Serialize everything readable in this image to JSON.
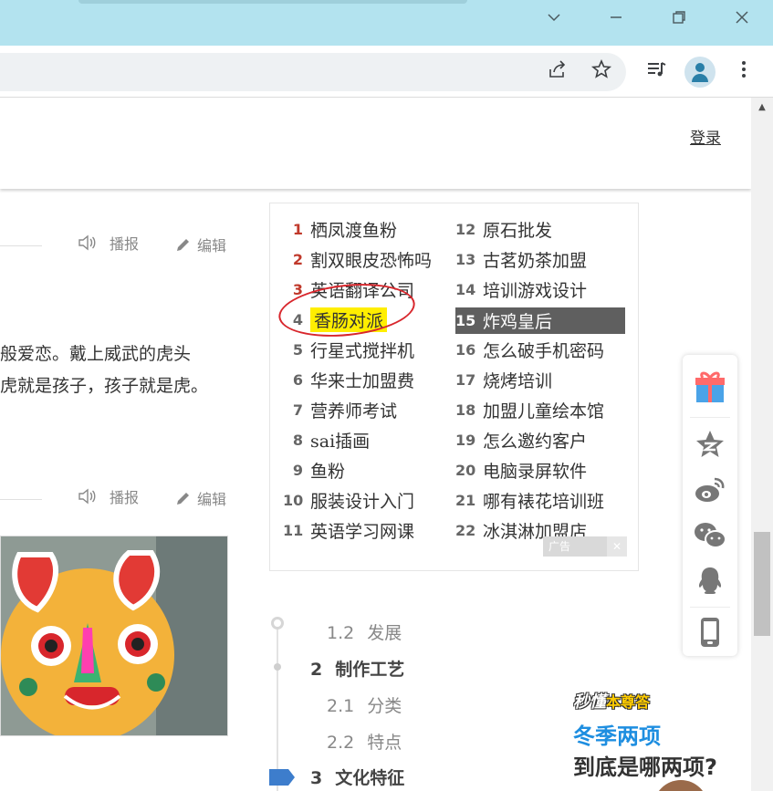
{
  "login_label": "登录",
  "actions": {
    "broadcast": "播报",
    "edit": "编辑"
  },
  "body_lines": [
    "般爱恋。戴上威武的虎头",
    "虎就是孩子，孩子就是虎。"
  ],
  "hot_list": {
    "left": [
      {
        "num": "1",
        "label": "栖凤渡鱼粉"
      },
      {
        "num": "2",
        "label": "割双眼皮恐怖吗"
      },
      {
        "num": "3",
        "label": "英语翻译公司"
      },
      {
        "num": "4",
        "label": "香肠对派"
      },
      {
        "num": "5",
        "label": "行星式搅拌机"
      },
      {
        "num": "6",
        "label": "华来士加盟费"
      },
      {
        "num": "7",
        "label": "营养师考试"
      },
      {
        "num": "8",
        "label": "sai插画"
      },
      {
        "num": "9",
        "label": "鱼粉"
      },
      {
        "num": "10",
        "label": "服装设计入门"
      },
      {
        "num": "11",
        "label": "英语学习网课"
      }
    ],
    "right": [
      {
        "num": "12",
        "label": "原石批发"
      },
      {
        "num": "13",
        "label": "古茗奶茶加盟"
      },
      {
        "num": "14",
        "label": "培训游戏设计"
      },
      {
        "num": "15",
        "label": "炸鸡皇后"
      },
      {
        "num": "16",
        "label": "怎么破手机密码"
      },
      {
        "num": "17",
        "label": "烧烤培训"
      },
      {
        "num": "18",
        "label": "加盟儿童绘本馆"
      },
      {
        "num": "19",
        "label": "怎么邀约客户"
      },
      {
        "num": "20",
        "label": "电脑录屏软件"
      },
      {
        "num": "21",
        "label": "哪有裱花培训班"
      },
      {
        "num": "22",
        "label": "冰淇淋加盟店"
      }
    ],
    "highlighted_index": 3,
    "active_index": 14
  },
  "ad_label": "广告",
  "toc": [
    {
      "num": "1.2",
      "label": "发展"
    },
    {
      "num": "2",
      "label": "制作工艺"
    },
    {
      "num": "2.1",
      "label": "分类"
    },
    {
      "num": "2.2",
      "label": "特点"
    },
    {
      "num": "3",
      "label": "文化特征"
    }
  ],
  "share_icons": [
    "gift-icon",
    "qzone-icon",
    "weibo-icon",
    "wechat-icon",
    "qq-icon",
    "mobile-icon"
  ],
  "promo": {
    "brand_a": "秒懂",
    "brand_b": "本尊答",
    "line1": "冬季两项",
    "line2": "到底是哪两项?"
  },
  "colors": {
    "titlebar": "#b3e3ef",
    "accent_blue": "#1e8ee0",
    "highlight": "#ffee00",
    "ring": "#d8262c",
    "active_row": "#5f5f5f"
  }
}
